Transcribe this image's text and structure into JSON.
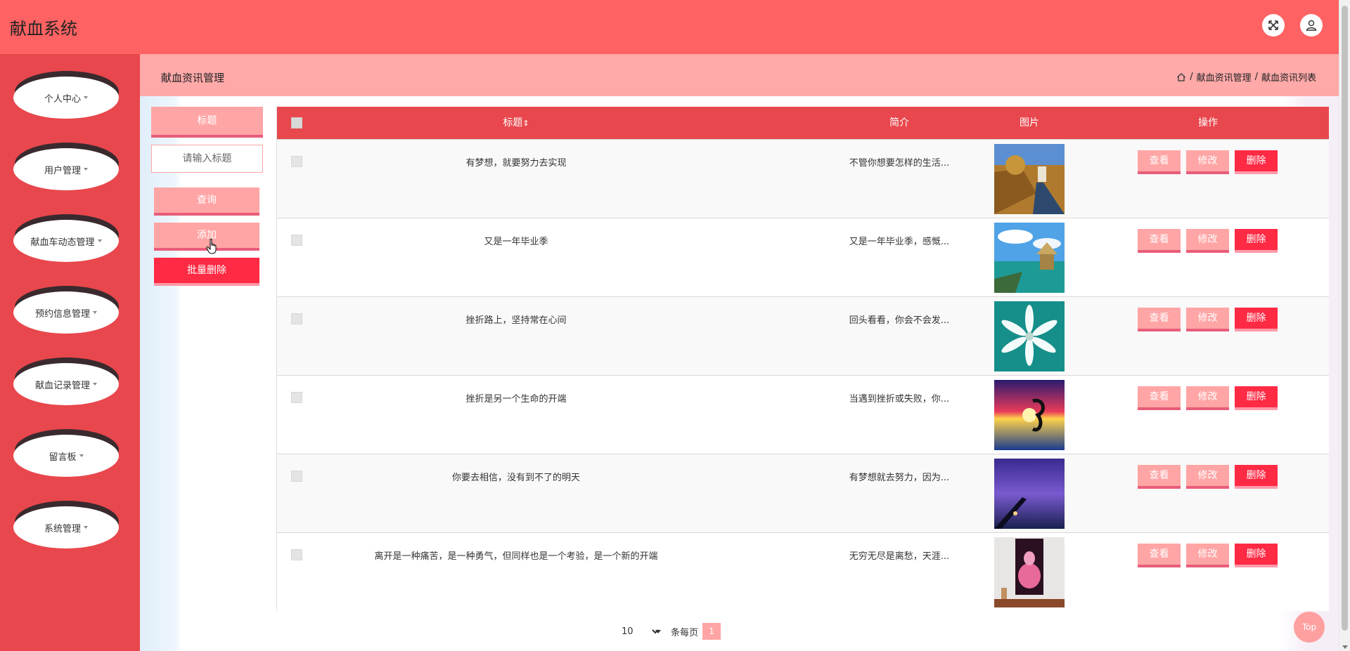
{
  "header": {
    "app_title": "献血系统",
    "fullscreen_icon": "expand-icon",
    "user_icon": "user-icon"
  },
  "sidebar": {
    "items": [
      {
        "label": "个人中心"
      },
      {
        "label": "用户管理"
      },
      {
        "label": "献血车动态管理"
      },
      {
        "label": "预约信息管理"
      },
      {
        "label": "献血记录管理"
      },
      {
        "label": "留言板"
      },
      {
        "label": "系统管理"
      }
    ]
  },
  "page": {
    "title": "献血资讯管理",
    "breadcrumb": [
      "献血资讯管理",
      "献血资讯列表"
    ],
    "breadcrumb_sep": "/"
  },
  "filter": {
    "label": "标题",
    "placeholder": "请输入标题",
    "search_label": "查询",
    "add_label": "添加",
    "batch_delete_label": "批量删除"
  },
  "table": {
    "columns": {
      "title": "标题",
      "sort_icon": "⇕",
      "intro": "简介",
      "image": "图片",
      "actions": "操作"
    },
    "action_labels": {
      "view": "查看",
      "edit": "修改",
      "delete": "删除"
    },
    "rows": [
      {
        "title": "有梦想，就要努力去实现",
        "intro": "不管你想要怎样的生活...",
        "image": "road-landscape"
      },
      {
        "title": "又是一年毕业季",
        "intro": "又是一年毕业季，感慨...",
        "image": "tropical-hut"
      },
      {
        "title": "挫折路上，坚持常在心间",
        "intro": "回头看看，你会不会发...",
        "image": "white-flower"
      },
      {
        "title": "挫折是另一个生命的开端",
        "intro": "当遇到挫折或失败，你...",
        "image": "sunset-reflection"
      },
      {
        "title": "你要去相信，没有到不了的明天",
        "intro": "有梦想就去努力，因为...",
        "image": "night-pier"
      },
      {
        "title": "离开是一种痛苦，是一种勇气，但同样也是一个考验，是一个新的开端",
        "intro": "无穷无尽是离愁，天涯...",
        "image": "pink-poster-room"
      }
    ]
  },
  "pagination": {
    "page_size": "10",
    "per_page_label": "条每页",
    "current_page": "1"
  },
  "back_to_top": "Top",
  "colors": {
    "header": "#ff6262",
    "sidebar": "#e8474d",
    "page_bar": "#ffa9a9",
    "button_light": "#ffa5a5",
    "button_danger": "#ff2a44"
  }
}
